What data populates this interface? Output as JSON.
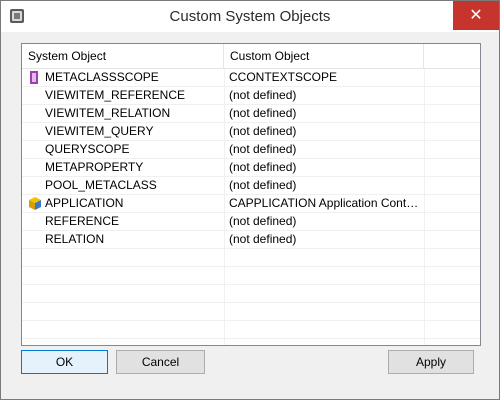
{
  "window": {
    "title": "Custom System Objects",
    "close_glyph": "✕"
  },
  "table": {
    "headers": [
      "System Object",
      "Custom Object"
    ],
    "rows": [
      {
        "name": "METACLASSSCOPE",
        "custom": "CCONTEXTSCOPE",
        "icon": "metaclass-icon"
      },
      {
        "name": "VIEWITEM_REFERENCE",
        "custom": "(not defined)",
        "icon": ""
      },
      {
        "name": "VIEWITEM_RELATION",
        "custom": "(not defined)",
        "icon": ""
      },
      {
        "name": "VIEWITEM_QUERY",
        "custom": "(not defined)",
        "icon": ""
      },
      {
        "name": "QUERYSCOPE",
        "custom": "(not defined)",
        "icon": ""
      },
      {
        "name": "METAPROPERTY",
        "custom": "(not defined)",
        "icon": ""
      },
      {
        "name": "POOL_METACLASS",
        "custom": "(not defined)",
        "icon": ""
      },
      {
        "name": "APPLICATION",
        "custom": "CAPPLICATION Application Context ...",
        "icon": "application-icon"
      },
      {
        "name": "REFERENCE",
        "custom": "(not defined)",
        "icon": ""
      },
      {
        "name": "RELATION",
        "custom": "(not defined)",
        "icon": ""
      }
    ]
  },
  "buttons": {
    "ok": "OK",
    "cancel": "Cancel",
    "apply": "Apply"
  }
}
